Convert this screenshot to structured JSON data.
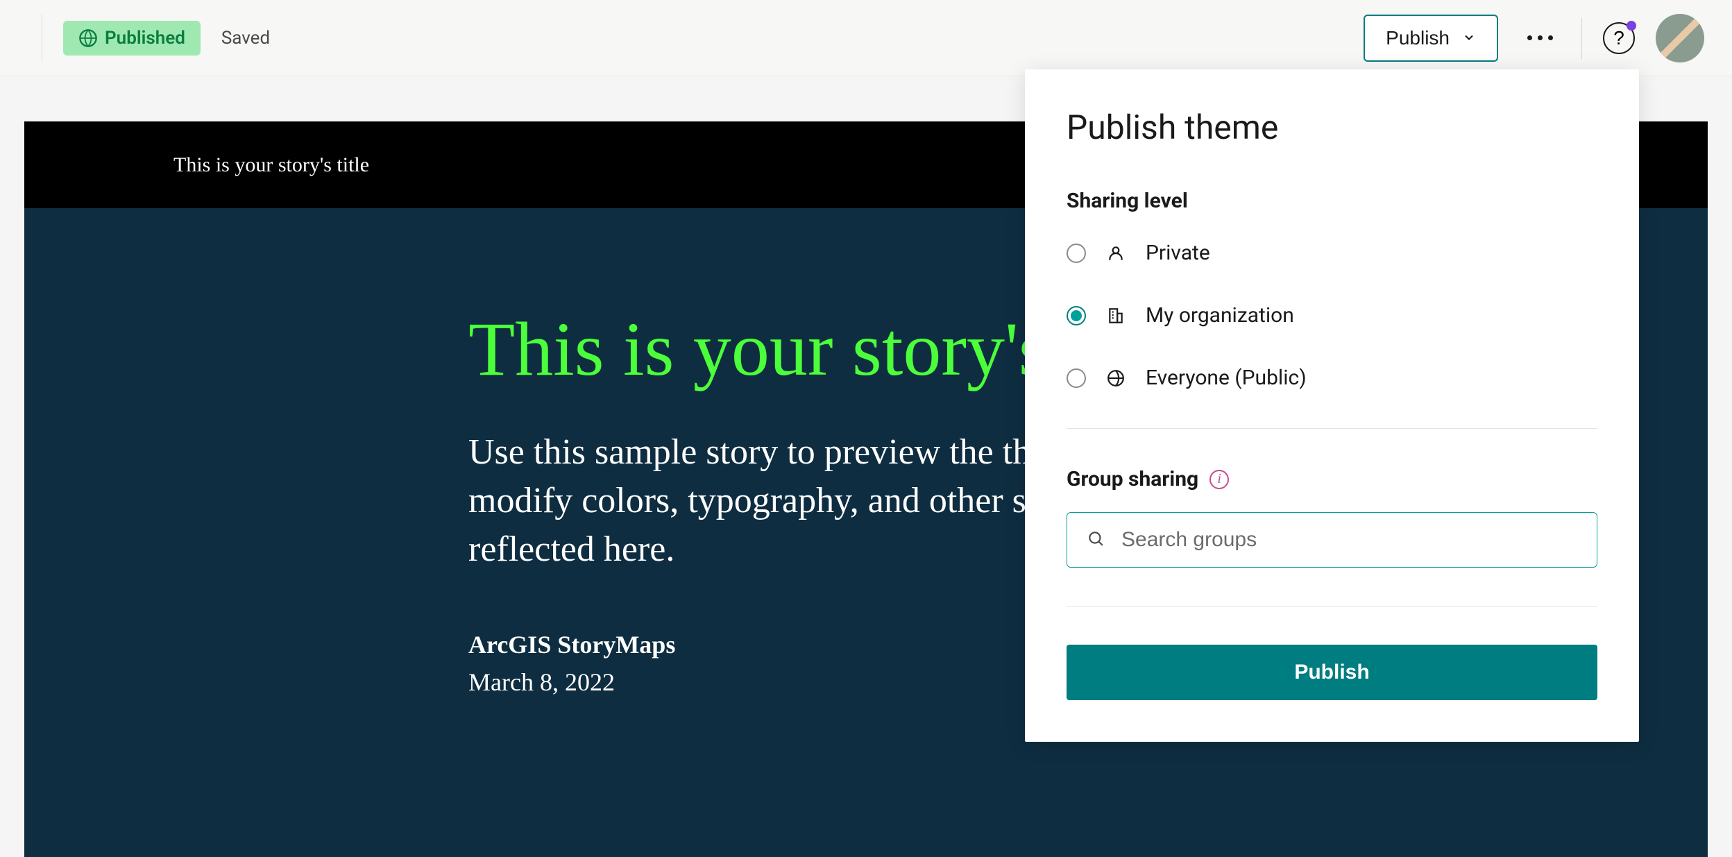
{
  "header": {
    "published_badge": "Published",
    "saved": "Saved",
    "publish_btn": "Publish"
  },
  "story": {
    "header_title": "This is your story's title",
    "title": "This is your story's title",
    "subtitle_line1": "Use this sample story to preview the theme you're building. As you",
    "subtitle_line2": "modify colors, typography, and other settings, the changes will be",
    "subtitle_line3": "reflected here.",
    "author": "ArcGIS StoryMaps",
    "date": "March 8, 2022"
  },
  "panel": {
    "title": "Publish theme",
    "sharing_level_label": "Sharing level",
    "options": {
      "private": "Private",
      "org": "My organization",
      "public": "Everyone (Public)"
    },
    "selected": "org",
    "group_sharing_label": "Group sharing",
    "search_placeholder": "Search groups",
    "publish_btn": "Publish"
  },
  "colors": {
    "accent": "#007d80",
    "badge_bg": "#9fe8b2",
    "badge_fg": "#0a7d3f",
    "story_bg": "#0e2d40",
    "story_title": "#4bff3a"
  }
}
